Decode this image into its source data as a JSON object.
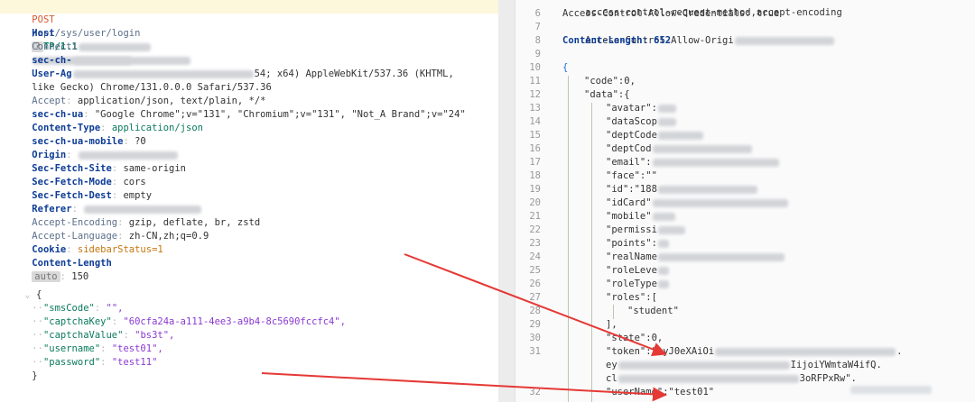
{
  "request": {
    "method": "POST",
    "path": "/api/sys/user/login",
    "protocol": "HTTP/1.1",
    "headers": [
      {
        "name": "Host",
        "value": ""
      },
      {
        "name": "Connecti",
        "value": ""
      },
      {
        "name": "sec-ch-",
        "value": ""
      },
      {
        "name": "User-Ag",
        "value": "54; x64) AppleWebKit/537.36 (KHTML,"
      },
      {
        "name": "like Gecko)",
        "value": "Chrome/131.0.0.0 Safari/537.36"
      },
      {
        "name": "Accept",
        "value": "application/json, text/plain, */*"
      },
      {
        "name": "sec-ch-ua",
        "value": "\"Google Chrome\";v=\"131\", \"Chromium\";v=\"131\", \"Not_A Brand\";v=\"24\""
      },
      {
        "name": "Content-Type",
        "value": "application/json"
      },
      {
        "name": "sec-ch-ua-mobile",
        "value": "?0"
      },
      {
        "name": "Origin",
        "value": ""
      },
      {
        "name": "Sec-Fetch-Site",
        "value": "same-origin"
      },
      {
        "name": "Sec-Fetch-Mode",
        "value": "cors"
      },
      {
        "name": "Sec-Fetch-Dest",
        "value": "empty"
      },
      {
        "name": "Referer",
        "value": ""
      },
      {
        "name": "Accept-Encoding",
        "value": "gzip, deflate, br, zstd"
      },
      {
        "name": "Accept-Language",
        "value": "zh-CN,zh;q=0.9"
      },
      {
        "name": "Cookie",
        "value": "sidebarStatus=1"
      },
      {
        "name": "Content-Length",
        "value": "150"
      }
    ],
    "auto_chip": "auto",
    "host_chip": "?",
    "body": {
      "open": "{",
      "close": "}",
      "fields": [
        {
          "key": "\"smsCode\"",
          "value": "\"\","
        },
        {
          "key": "\"captchaKey\"",
          "value": "\"60cfa24a-a111-4ee3-a9b4-8c5690fccfc4\","
        },
        {
          "key": "\"captchaValue\"",
          "value": "\"bs3t\","
        },
        {
          "key": "\"username\"",
          "value": "\"test01\","
        },
        {
          "key": "\"password\"",
          "value": "\"test11\""
        }
      ]
    }
  },
  "response": {
    "top_line": "access-control-request-method,accept-encoding",
    "lines": [
      {
        "n": "6",
        "text": "Access-Control-Allow-Credentials: true"
      },
      {
        "n": "7",
        "text": "Access-Control-Allow-Origi"
      },
      {
        "n": "8",
        "text": "Content-Length: 652"
      },
      {
        "n": "9",
        "text": ""
      },
      {
        "n": "10",
        "text": "{"
      },
      {
        "n": "11",
        "text": "\"code\":0,"
      },
      {
        "n": "12",
        "text": "\"data\":{"
      },
      {
        "n": "13",
        "text": "\"avatar\":"
      },
      {
        "n": "14",
        "text": "\"dataScop"
      },
      {
        "n": "15",
        "text": "\"deptCode"
      },
      {
        "n": "16",
        "text": "\"deptCod"
      },
      {
        "n": "17",
        "text": "\"email\":"
      },
      {
        "n": "18",
        "text": "\"face\":\"\""
      },
      {
        "n": "19",
        "text": "\"id\":\"188"
      },
      {
        "n": "20",
        "text": "\"idCard\""
      },
      {
        "n": "21",
        "text": "\"mobile\""
      },
      {
        "n": "22",
        "text": "\"permissi"
      },
      {
        "n": "23",
        "text": "\"points\":"
      },
      {
        "n": "24",
        "text": "\"realName"
      },
      {
        "n": "25",
        "text": "\"roleLeve"
      },
      {
        "n": "26",
        "text": "\"roleType"
      },
      {
        "n": "27",
        "text": "\"roles\":["
      },
      {
        "n": "28",
        "text": "\"student\""
      },
      {
        "n": "29",
        "text": "],"
      },
      {
        "n": "30",
        "text": "\"state\":0,"
      },
      {
        "n": "31",
        "text": "\"token\":\"eyJ0eXAiOi"
      },
      {
        "n": "",
        "text": "ey"
      },
      {
        "n": "",
        "text": "cl"
      },
      {
        "n": "32",
        "text": "\"userName\":\"test01\""
      }
    ],
    "token_tail_1": "IijoiYWmtaW4ifQ.",
    "token_tail_2": "3oRFPxRw\".",
    "token_tail_0": "."
  },
  "colors": {
    "arrow": "#e53935"
  }
}
